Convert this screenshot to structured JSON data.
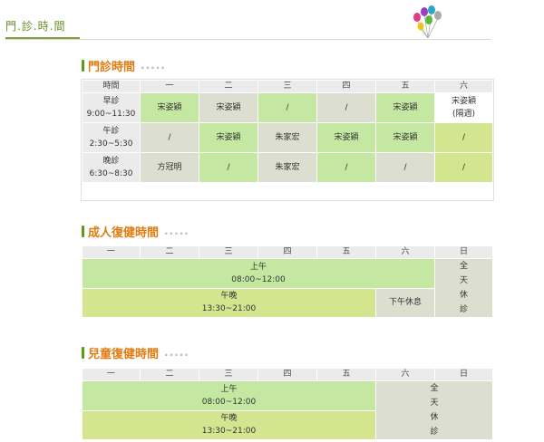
{
  "page": {
    "title": "門.診.時.間"
  },
  "clinic": {
    "title": "門診時間",
    "headers": [
      "時間",
      "一",
      "二",
      "三",
      "四",
      "五",
      "六"
    ],
    "morning": {
      "label": "早診",
      "time": "9:00~11:30",
      "cells": [
        "宋姿穎",
        "宋姿穎",
        "/",
        "/",
        "宋姿穎",
        "宋姿穎",
        "(隔週)"
      ]
    },
    "afternoon": {
      "label": "午診",
      "time": "2:30~5:30",
      "cells": [
        "/",
        "宋姿穎",
        "朱家宏",
        "宋姿穎",
        "宋姿穎",
        "/"
      ]
    },
    "evening": {
      "label": "晚診",
      "time": "6:30~8:30",
      "cells": [
        "方冠明",
        "/",
        "朱家宏",
        "/",
        "/",
        "/"
      ]
    }
  },
  "adult": {
    "title": "成人復健時間",
    "headers": [
      "一",
      "二",
      "三",
      "四",
      "五",
      "六",
      "日"
    ],
    "morning": {
      "label": "上午",
      "time": "08:00~12:00"
    },
    "evening": {
      "label": "午晚",
      "time": "13:30~21:00"
    },
    "sat_pm": "下午休息",
    "closed": [
      "全",
      "天",
      "休",
      "診"
    ]
  },
  "child": {
    "title": "兒童復健時間",
    "headers": [
      "一",
      "二",
      "三",
      "四",
      "五",
      "六",
      "日"
    ],
    "morning": {
      "label": "上午",
      "time": "08:00~12:00"
    },
    "evening": {
      "label": "午晚",
      "time": "13:30~21:00"
    },
    "closed": [
      "全",
      "天",
      "休",
      "診"
    ]
  },
  "colors": {
    "accent_green": "#6a8e2a",
    "title_orange": "#e07b10",
    "cell_green": "#c4e8a2",
    "cell_gray": "#dcdfcf",
    "cell_yellow_green": "#d4e58f"
  },
  "icons": [
    "balloons-icon"
  ]
}
